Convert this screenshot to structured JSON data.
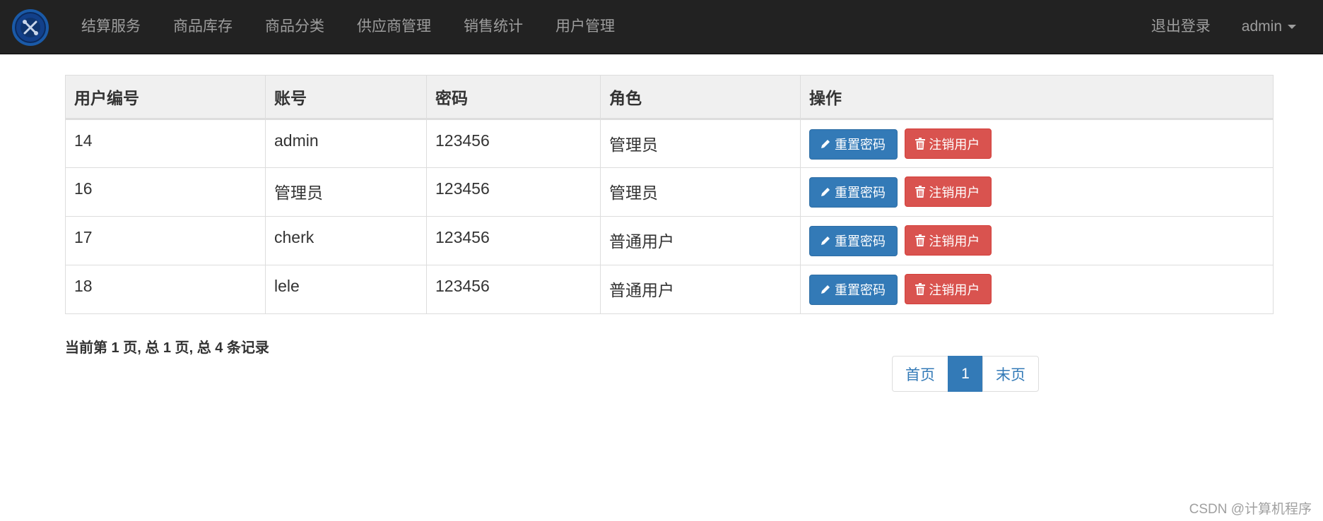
{
  "nav": {
    "items": [
      {
        "label": "结算服务"
      },
      {
        "label": "商品库存"
      },
      {
        "label": "商品分类"
      },
      {
        "label": "供应商管理"
      },
      {
        "label": "销售统计"
      },
      {
        "label": "用户管理"
      }
    ],
    "logout_label": "退出登录",
    "user_label": "admin"
  },
  "table": {
    "headers": [
      "用户编号",
      "账号",
      "密码",
      "角色",
      "操作"
    ],
    "rows": [
      {
        "id": "14",
        "account": "admin",
        "password": "123456",
        "role": "管理员"
      },
      {
        "id": "16",
        "account": "管理员",
        "password": "123456",
        "role": "管理员"
      },
      {
        "id": "17",
        "account": "cherk",
        "password": "123456",
        "role": "普通用户"
      },
      {
        "id": "18",
        "account": "lele",
        "password": "123456",
        "role": "普通用户"
      }
    ],
    "reset_label": "重置密码",
    "delete_label": "注销用户"
  },
  "pager": {
    "info": "当前第 1 页, 总 1 页, 总 4 条记录",
    "first_label": "首页",
    "current": "1",
    "last_label": "末页"
  },
  "watermark": "CSDN @计算机程序",
  "colors": {
    "navbar": "#222222",
    "primary": "#337ab7",
    "danger": "#d9534f"
  }
}
